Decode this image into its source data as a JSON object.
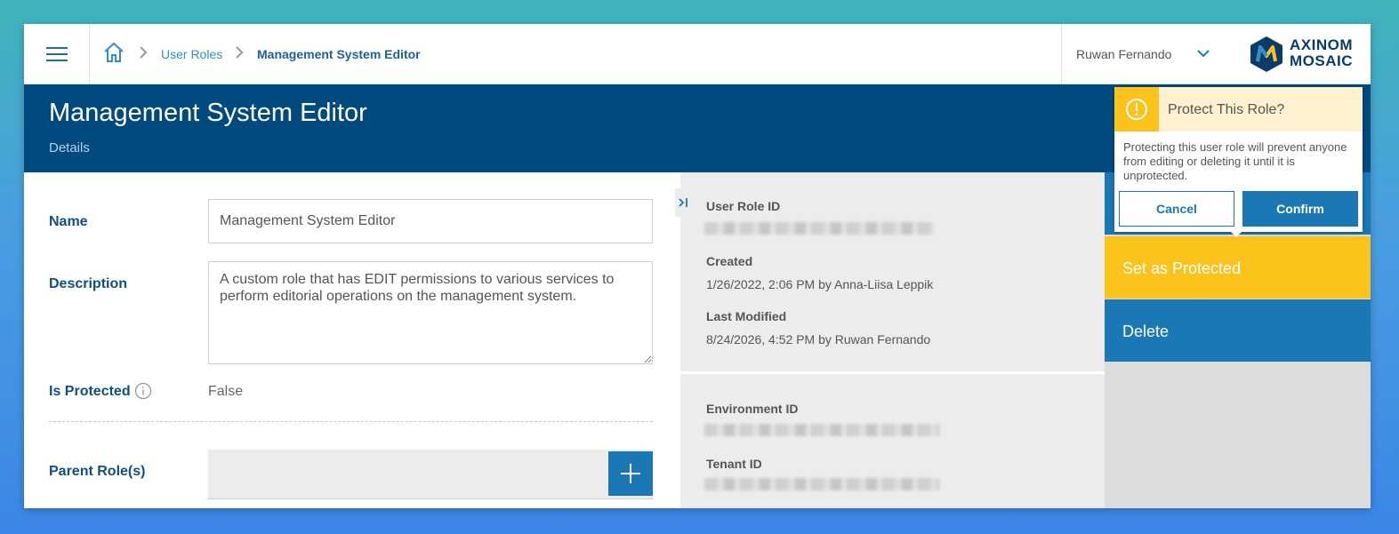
{
  "breadcrumb": {
    "items": [
      "User Roles"
    ],
    "current": "Management System Editor"
  },
  "user": {
    "name": "Ruwan Fernando"
  },
  "logo": {
    "line1": "AXINOM",
    "line2": "MOSAIC"
  },
  "header": {
    "title": "Management System Editor",
    "subtitle": "Details"
  },
  "form": {
    "name_label": "Name",
    "name_value": "Management System Editor",
    "description_label": "Description",
    "description_value": "A custom role that has EDIT permissions to various services to perform editorial operations on the management system.",
    "protected_label": "Is Protected",
    "protected_value": "False",
    "parent_label": "Parent Role(s)"
  },
  "details": {
    "user_role_id_label": "User Role ID",
    "created_label": "Created",
    "created_value": "1/26/2022, 2:06 PM by Anna-Liisa Leppik",
    "modified_label": "Last Modified",
    "modified_value": "8/24/2026, 4:52 PM by Ruwan Fernando",
    "environment_id_label": "Environment ID",
    "tenant_id_label": "Tenant ID"
  },
  "actions": {
    "protect_label": "Set as Protected",
    "delete_label": "Delete"
  },
  "popover": {
    "title": "Protect This Role?",
    "body": "Protecting this user role will prevent anyone from editing or deleting it until it is unprotected.",
    "cancel_label": "Cancel",
    "confirm_label": "Confirm"
  },
  "icons": [
    "menu-icon",
    "home-icon",
    "chevron-right-icon",
    "chevron-down-icon",
    "info-icon",
    "plus-icon",
    "collapse-panel-icon",
    "warning-icon"
  ],
  "colors": {
    "primary": "#1a78b4",
    "header": "#004a7f",
    "warning": "#fcc31d",
    "label": "#0e4f86"
  }
}
